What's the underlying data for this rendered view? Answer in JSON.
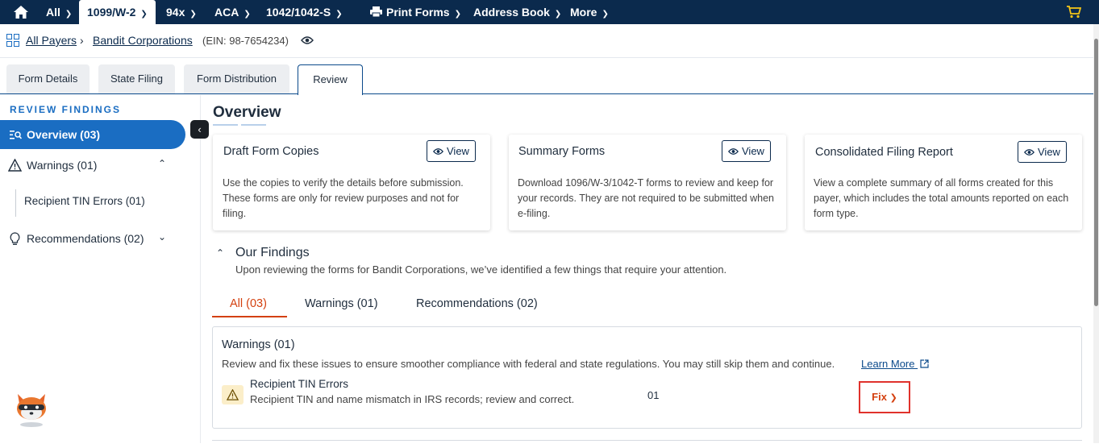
{
  "topnav": {
    "items": [
      {
        "label": "All"
      },
      {
        "label": "1099/W-2"
      },
      {
        "label": "94x"
      },
      {
        "label": "ACA"
      },
      {
        "label": "1042/1042-S"
      },
      {
        "label": "Print Forms"
      },
      {
        "label": "Address Book"
      },
      {
        "label": "More"
      }
    ]
  },
  "breadcrumb": {
    "all_payers": "All Payers",
    "payer": "Bandit Corporations",
    "ein": "(EIN: 98-7654234)"
  },
  "tabs": [
    {
      "label": "Form Details"
    },
    {
      "label": "State Filing"
    },
    {
      "label": "Form Distribution"
    },
    {
      "label": "Review"
    }
  ],
  "sidebar": {
    "title": "REVIEW FINDINGS",
    "overview": "Overview (03)",
    "warnings": "Warnings (01)",
    "warnings_sub": "Recipient TIN Errors (01)",
    "recommendations": "Recommendations (02)"
  },
  "main": {
    "heading": "Overview",
    "cards": [
      {
        "title": "Draft Form Copies",
        "view": "View",
        "desc": "Use the copies to verify the details before submission. These forms are only for review purposes and not for filing."
      },
      {
        "title": "Summary Forms",
        "view": "View",
        "desc": "Download 1096/W-3/1042-T forms to review and keep for your records. They are not required to be submitted when e-filing."
      },
      {
        "title": "Consolidated Filing Report",
        "view": "View",
        "desc": "View a complete summary of all forms created for this payer, which includes the total amounts reported on each form type."
      }
    ],
    "findings": {
      "title": "Our Findings",
      "desc": "Upon reviewing the forms for Bandit Corporations, we’ve identified a few things that require your attention.",
      "tabs": [
        {
          "label": "All (03)"
        },
        {
          "label": "Warnings (01)"
        },
        {
          "label": "Recommendations (02)"
        }
      ]
    },
    "warning_box": {
      "title": "Warnings (01)",
      "desc": "Review and fix these issues to ensure smoother compliance with federal and state regulations. You may still skip them and continue.",
      "learn_more": "Learn More",
      "item_title": "Recipient TIN Errors",
      "item_desc": "Recipient TIN and name mismatch in IRS records; review and correct.",
      "item_count": "01",
      "fix": "Fix"
    }
  },
  "colors": {
    "nav_bg": "#0b2a4d",
    "accent": "#1a6dc2",
    "fix_text": "#d4400f",
    "highlight_border": "#e0322c",
    "cart_yellow": "#f5c518"
  }
}
